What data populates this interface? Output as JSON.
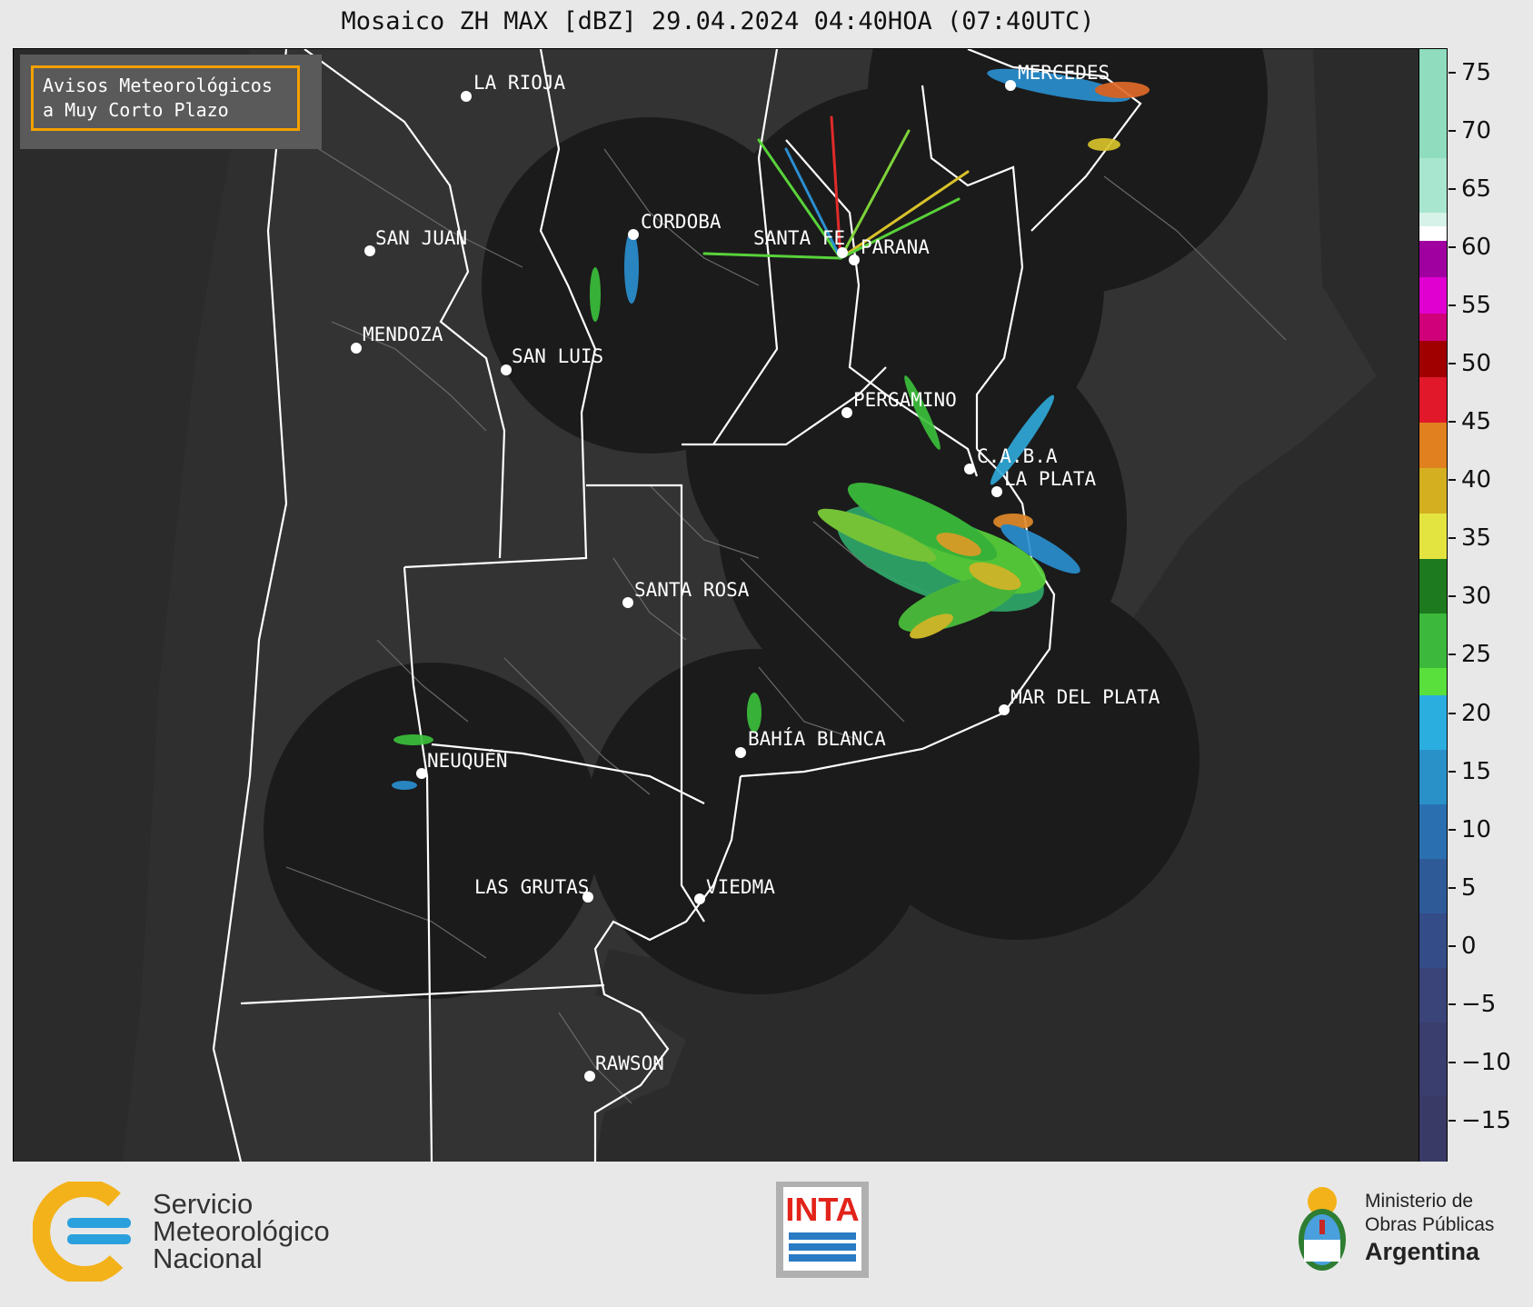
{
  "title": "Mosaico ZH MAX [dBZ] 29.04.2024 04:40HOA (07:40UTC)",
  "badge": {
    "line1": "Avisos Meteorológicos",
    "line2": "a Muy Corto Plazo"
  },
  "cities": [
    {
      "name": "LA RIOJA"
    },
    {
      "name": "MERCEDES"
    },
    {
      "name": "CORDOBA"
    },
    {
      "name": "SAN JUAN"
    },
    {
      "name": "SANTA FE"
    },
    {
      "name": "PARANA"
    },
    {
      "name": "MENDOZA"
    },
    {
      "name": "SAN LUIS"
    },
    {
      "name": "PERGAMINO"
    },
    {
      "name": "C.A.B.A"
    },
    {
      "name": "LA PLATA"
    },
    {
      "name": "SANTA ROSA"
    },
    {
      "name": "MAR DEL PLATA"
    },
    {
      "name": "BAHÍA BLANCA"
    },
    {
      "name": "NEUQUÉN"
    },
    {
      "name": "LAS GRUTAS"
    },
    {
      "name": "VIEDMA"
    },
    {
      "name": "RAWSON"
    }
  ],
  "colorbar": {
    "unit": "dBZ",
    "min": -18.5,
    "max": 77,
    "ticks": [
      "75",
      "70",
      "65",
      "60",
      "55",
      "50",
      "45",
      "40",
      "35",
      "30",
      "25",
      "20",
      "15",
      "10",
      "5",
      "0",
      "−5",
      "−10",
      "−15"
    ],
    "tick_values": [
      75,
      70,
      65,
      60,
      55,
      50,
      45,
      40,
      35,
      30,
      25,
      20,
      15,
      10,
      5,
      0,
      -5,
      -10,
      -15
    ]
  },
  "footer": {
    "smn": {
      "line1": "Servicio",
      "line2": "Meteorológico",
      "line3": "Nacional"
    },
    "inta": "INTA",
    "ministry": {
      "line1": "Ministerio de",
      "line2": "Obras Públicas",
      "line3": "Argentina"
    }
  }
}
